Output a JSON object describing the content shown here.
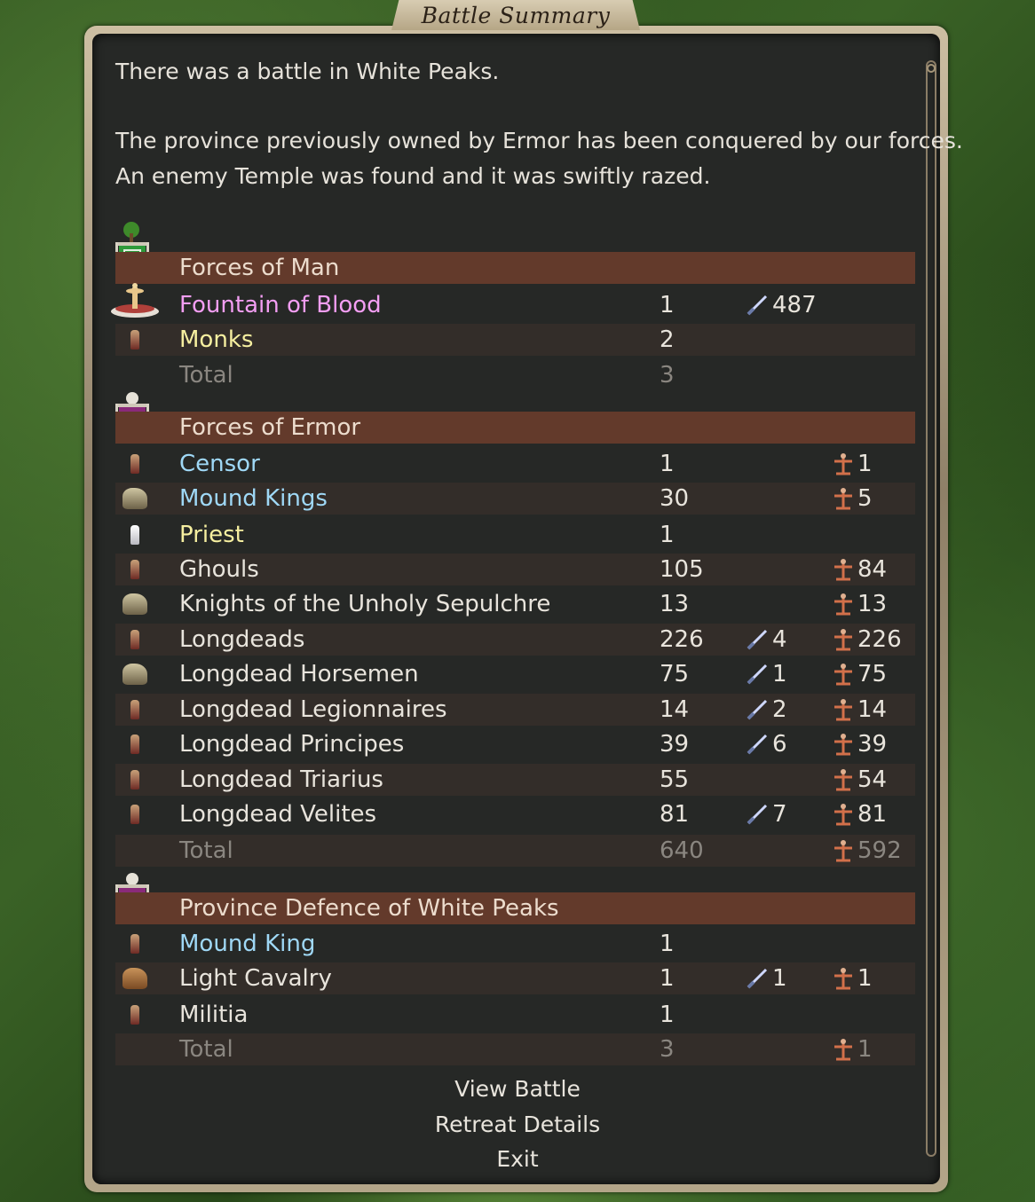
{
  "window": {
    "title": "Battle Summary"
  },
  "messages": [
    "There was a battle in White Peaks.",
    "The province previously owned by Ermor has been conquered by our forces.",
    "An enemy Temple was found and it was swiftly razed."
  ],
  "sections": [
    {
      "header": "Forces of Man",
      "banner": "green-tree-banner-icon",
      "units": [
        {
          "name": "Fountain of Blood",
          "color": "pink",
          "icon": "fountain-icon",
          "count": "1",
          "kills": "487",
          "lost": ""
        },
        {
          "name": "Monks",
          "color": "yellow",
          "icon": "monk-icon",
          "count": "2",
          "kills": "",
          "lost": ""
        }
      ],
      "total": {
        "label": "Total",
        "count": "3",
        "lost": ""
      }
    },
    {
      "header": "Forces of Ermor",
      "banner": "purple-skull-banner-icon",
      "units": [
        {
          "name": "Censor",
          "color": "blue",
          "icon": "censor-icon",
          "count": "1",
          "kills": "",
          "lost": "1"
        },
        {
          "name": "Mound Kings",
          "color": "blue",
          "icon": "mounted-king-icon",
          "count": "30",
          "kills": "",
          "lost": "5"
        },
        {
          "name": "Priest",
          "color": "yellow",
          "icon": "priest-icon",
          "count": "1",
          "kills": "",
          "lost": ""
        },
        {
          "name": "Ghouls",
          "color": "white",
          "icon": "ghoul-icon",
          "count": "105",
          "kills": "",
          "lost": "84"
        },
        {
          "name": "Knights of the Unholy Sepulchre",
          "color": "white",
          "icon": "knight-icon",
          "count": "13",
          "kills": "",
          "lost": "13"
        },
        {
          "name": "Longdeads",
          "color": "white",
          "icon": "longdead-icon",
          "count": "226",
          "kills": "4",
          "lost": "226"
        },
        {
          "name": "Longdead Horsemen",
          "color": "white",
          "icon": "horseman-icon",
          "count": "75",
          "kills": "1",
          "lost": "75"
        },
        {
          "name": "Longdead Legionnaires",
          "color": "white",
          "icon": "legionnaire-icon",
          "count": "14",
          "kills": "2",
          "lost": "14"
        },
        {
          "name": "Longdead Principes",
          "color": "white",
          "icon": "principes-icon",
          "count": "39",
          "kills": "6",
          "lost": "39"
        },
        {
          "name": "Longdead Triarius",
          "color": "white",
          "icon": "triarius-icon",
          "count": "55",
          "kills": "",
          "lost": "54"
        },
        {
          "name": "Longdead Velites",
          "color": "white",
          "icon": "velites-icon",
          "count": "81",
          "kills": "7",
          "lost": "81"
        }
      ],
      "total": {
        "label": "Total",
        "count": "640",
        "lost": "592"
      }
    },
    {
      "header": "Province Defence of White Peaks",
      "banner": "purple-skull-banner-icon",
      "units": [
        {
          "name": "Mound King",
          "color": "blue",
          "icon": "mound-king-icon",
          "count": "1",
          "kills": "",
          "lost": ""
        },
        {
          "name": "Light Cavalry",
          "color": "white",
          "icon": "light-cavalry-icon",
          "count": "1",
          "kills": "1",
          "lost": "1"
        },
        {
          "name": "Militia",
          "color": "white",
          "icon": "militia-icon",
          "count": "1",
          "kills": "",
          "lost": ""
        }
      ],
      "total": {
        "label": "Total",
        "count": "3",
        "lost": "1"
      }
    }
  ],
  "buttons": {
    "view_battle": "View Battle",
    "retreat_details": "Retreat Details",
    "exit": "Exit"
  },
  "colors": {
    "header_bg": "#633a2b",
    "row_alt_bg": "#332d29",
    "panel_bg": "#262826"
  }
}
